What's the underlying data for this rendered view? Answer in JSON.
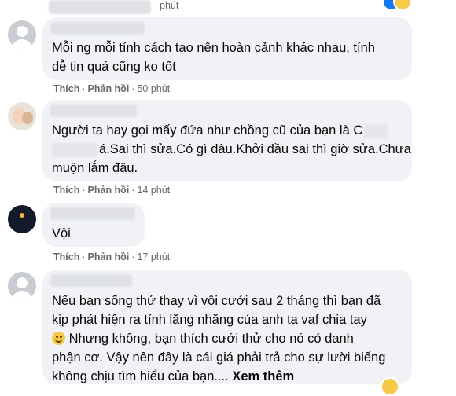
{
  "top_partial": {
    "time": "phút"
  },
  "comments": [
    {
      "text_lines": [
        "Mỗi ng mỗi tính cách tạo nên hoàn cảnh khác nhau, tính",
        "dễ tin quá cũng ko tốt"
      ],
      "like_label": "Thích",
      "reply_label": "Phản hồi",
      "time": "50 phút"
    },
    {
      "text_lines": [
        "Người ta hay gọi mấy đứa như chồng cũ của bạn là C",
        "á.Sai thì sửa.Có gì đâu.Khởi đầu sai thì giờ sửa.Chưa",
        "muộn lắm đâu."
      ],
      "like_label": "Thích",
      "reply_label": "Phản hồi",
      "time": "14 phút"
    },
    {
      "text_lines": [
        "Vội"
      ],
      "like_label": "Thích",
      "reply_label": "Phản hồi",
      "time": "17 phút"
    },
    {
      "text_lines": [
        "Nếu bạn sống thử thay vì vội cưới sau 2 tháng thì bạn đã",
        "kịp phát hiện ra tính lăng nhăng của anh ta vaf chia tay",
        " Nhưng không, bạn thích cưới thử cho nó có danh",
        "phận cơ. Vậy nên đây là cái giá phải trả cho sự lười biếng",
        "không chịu tìm hiểu của bạn.... "
      ],
      "see_more": "Xem thêm"
    }
  ],
  "colors": {
    "bubble": "#f0f2f5",
    "meta": "#65676b",
    "text": "#050505"
  }
}
